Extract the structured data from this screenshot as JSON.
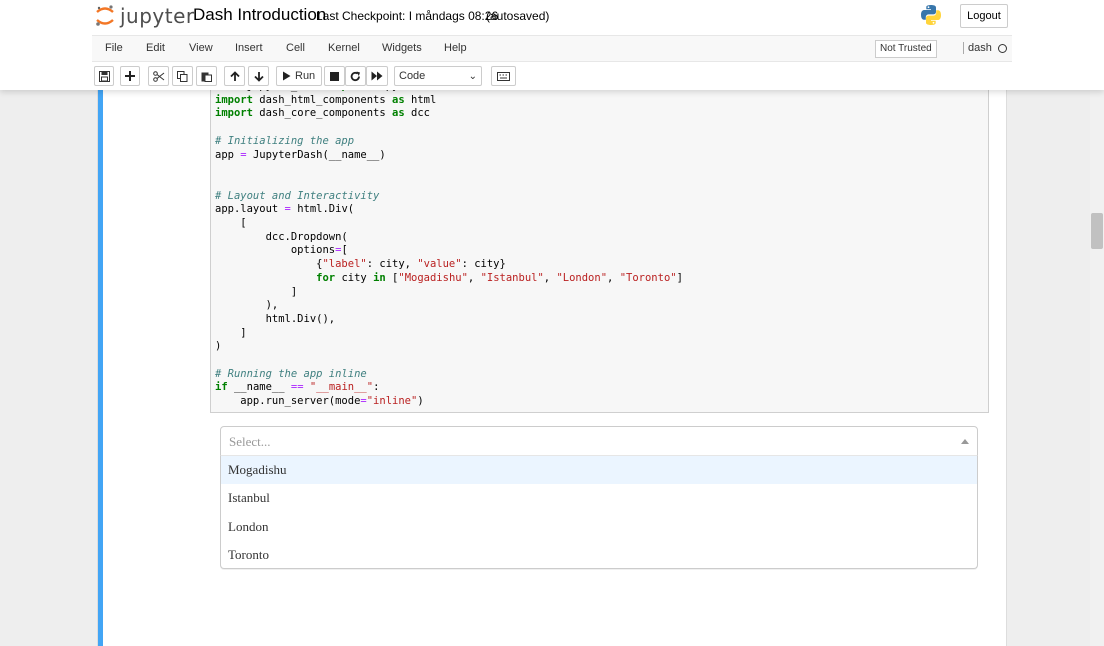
{
  "header": {
    "logo_text": "jupyter",
    "notebook_title": "Dash Introduction",
    "checkpoint": "Last Checkpoint: I måndags 08:26",
    "autosave_status": "(autosaved)",
    "logout_label": "Logout"
  },
  "menubar": {
    "items": [
      "File",
      "Edit",
      "View",
      "Insert",
      "Cell",
      "Kernel",
      "Widgets",
      "Help"
    ],
    "trust_label": "Not Trusted",
    "kernel_name": "dash"
  },
  "toolbar": {
    "run_label": "Run",
    "cell_type": "Code"
  },
  "code_cell": {
    "lines": [
      "from jupyter_dash import JupyterDash",
      "import dash_html_components as html",
      "import dash_core_components as dcc",
      "",
      "# Initializing the app",
      "app = JupyterDash(__name__)",
      "",
      "",
      "# Layout and Interactivity",
      "app.layout = html.Div(",
      "    [",
      "        dcc.Dropdown(",
      "            options=[",
      "                {\"label\": city, \"value\": city}",
      "                for city in [\"Mogadishu\", \"Istanbul\", \"London\", \"Toronto\"]",
      "            ]",
      "        ),",
      "        html.Div(),",
      "    ]",
      ")",
      "",
      "# Running the app inline",
      "if __name__ == \"__main__\":",
      "    app.run_server(mode=\"inline\")"
    ]
  },
  "dropdown": {
    "placeholder": "Select...",
    "options": [
      "Mogadishu",
      "Istanbul",
      "London",
      "Toronto"
    ],
    "focused_index": 0
  },
  "colors": {
    "cell_marker": "#42a5f5",
    "focused_option": "#ebf5ff",
    "jupyter_orange": "#f37726"
  }
}
